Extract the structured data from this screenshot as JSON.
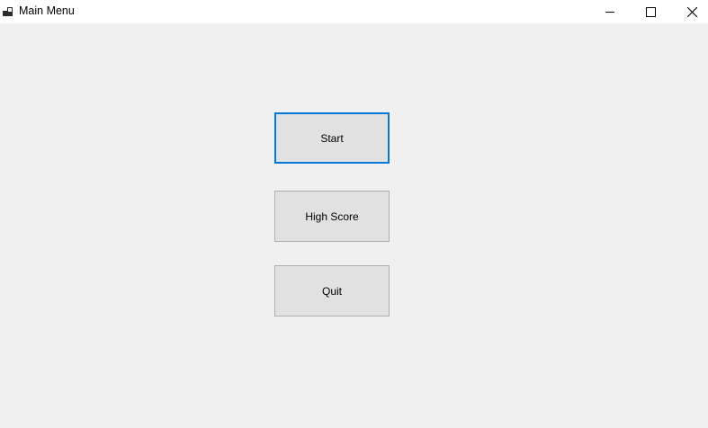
{
  "window": {
    "title": "Main Menu",
    "app_icon": "form-icon",
    "caption_buttons": {
      "minimize_icon": "minimize-icon",
      "maximize_icon": "maximize-icon",
      "close_icon": "close-icon"
    }
  },
  "menu": {
    "start_label": "Start",
    "high_score_label": "High Score",
    "quit_label": "Quit",
    "focused_button": "Start"
  },
  "colors": {
    "client_background": "#f0f0f0",
    "titlebar_background": "#ffffff",
    "button_face": "#e1e1e1",
    "button_border": "#adadad",
    "focus_border": "#0078d7"
  }
}
